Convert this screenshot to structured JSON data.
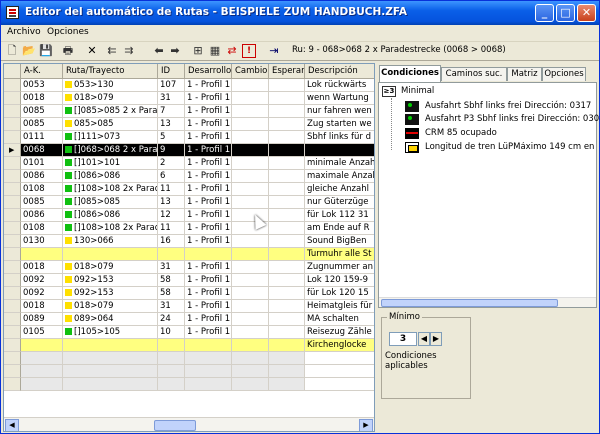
{
  "window": {
    "title": "Editor del automático de Rutas - BEISPIELE ZUM HANDBUCH.ZFA",
    "controls": {
      "minimize": "_",
      "maximize": "□",
      "close": "✕"
    }
  },
  "menu": {
    "items": [
      "Archivo",
      "Opciones"
    ]
  },
  "toolbar": {
    "route_label": "Ru: 9 - 068>068 2 x Paradestrecke (0068 > 0068)"
  },
  "table": {
    "columns": [
      "A-K.",
      "Ruta/Trayecto",
      "ID",
      "Desarrollo",
      "Cambio",
      "Esperar",
      "Descripción"
    ],
    "rows": [
      {
        "ak": "0053",
        "dot": "y",
        "route": "053>130",
        "id": "107",
        "des": "1 - Profil 1",
        "desc": "Lok rückwärts"
      },
      {
        "ak": "0018",
        "dot": "y",
        "route": "018>079",
        "id": "31",
        "des": "1 - Profil 1",
        "desc": "wenn Wartung"
      },
      {
        "ak": "0085",
        "dot": "g",
        "route": "[]085>085 2 x Parades",
        "id": "7",
        "des": "1 - Profil 1",
        "desc": "nur fahren wen"
      },
      {
        "ak": "0085",
        "dot": "y",
        "route": "085>085",
        "id": "13",
        "des": "1 - Profil 1",
        "desc": "Zug starten we"
      },
      {
        "ak": "0111",
        "dot": "g",
        "route": "[]111>073",
        "id": "5",
        "des": "1 - Profil 1",
        "desc": "Sbhf links für d"
      },
      {
        "ak": "0068",
        "dot": "g",
        "route": "[]068>068 2 x Parades",
        "id": "9",
        "des": "1 - Profil 1",
        "desc": ""
      },
      {
        "ak": "0101",
        "dot": "g",
        "route": "[]101>101",
        "id": "2",
        "des": "1 - Profil 1",
        "desc": "minimale Anzah"
      },
      {
        "ak": "0086",
        "dot": "g",
        "route": "[]086>086",
        "id": "6",
        "des": "1 - Profil 1",
        "desc": "maximale Anzah"
      },
      {
        "ak": "0108",
        "dot": "g",
        "route": "[]108>108 2x Paradest",
        "id": "11",
        "des": "1 - Profil 1",
        "desc": "gleiche Anzahl"
      },
      {
        "ak": "0085",
        "dot": "g",
        "route": "[]085>085",
        "id": "13",
        "des": "1 - Profil 1",
        "desc": "nur Güterzüge"
      },
      {
        "ak": "0086",
        "dot": "g",
        "route": "[]086>086",
        "id": "12",
        "des": "1 - Profil 1",
        "desc": "für Lok 112 31"
      },
      {
        "ak": "0108",
        "dot": "g",
        "route": "[]108>108 2x Paradest",
        "id": "11",
        "des": "1 - Profil 1",
        "desc": "am Ende auf R"
      },
      {
        "ak": "0130",
        "dot": "y",
        "route": "130>066",
        "id": "16",
        "des": "1 - Profil 1",
        "desc": "Sound BigBen"
      },
      {
        "ak": "",
        "dot": "",
        "route": "",
        "id": "",
        "des": "",
        "desc": "Turmuhr alle St"
      },
      {
        "ak": "0018",
        "dot": "y",
        "route": "018>079",
        "id": "31",
        "des": "1 - Profil 1",
        "desc": "Zugnummer an"
      },
      {
        "ak": "0092",
        "dot": "y",
        "route": "092>153",
        "id": "58",
        "des": "1 - Profil 1",
        "desc": "Lok 120 159-9"
      },
      {
        "ak": "0092",
        "dot": "y",
        "route": "092>153",
        "id": "58",
        "des": "1 - Profil 1",
        "desc": "für Lok 120 15"
      },
      {
        "ak": "0018",
        "dot": "y",
        "route": "018>079",
        "id": "31",
        "des": "1 - Profil 1",
        "desc": "Heimatgleis für"
      },
      {
        "ak": "0089",
        "dot": "y",
        "route": "089>064",
        "id": "24",
        "des": "1 - Profil 1",
        "desc": "MA schalten"
      },
      {
        "ak": "0105",
        "dot": "g",
        "route": "[]105>105",
        "id": "10",
        "des": "1 - Profil 1",
        "desc": "Reisezug Zähle"
      },
      {
        "ak": "",
        "dot": "",
        "route": "",
        "id": "",
        "des": "",
        "desc": "Kirchenglocke"
      }
    ]
  },
  "panel": {
    "tabs": [
      "Condiciones",
      "Caminos suc.",
      "Matriz",
      "Opciones"
    ],
    "tree": {
      "root_badge": "≥3",
      "root_label": "Minimal",
      "items": [
        {
          "icon": "signal-icon",
          "label": "Ausfahrt Sbhf links frei Dirección: 0317"
        },
        {
          "icon": "signal-icon",
          "label": "Ausfahrt P3 Sbhf links frei Dirección: 0308"
        },
        {
          "icon": "track-occupied-icon",
          "label": "CRM 85 ocupado"
        },
        {
          "icon": "train-length-icon",
          "label": "Longitud de tren LüPMáximo 149 cm en conta"
        }
      ]
    },
    "minimum": {
      "group_label": "Mínimo",
      "value": "3",
      "caption": "Condiciones aplicables"
    }
  }
}
